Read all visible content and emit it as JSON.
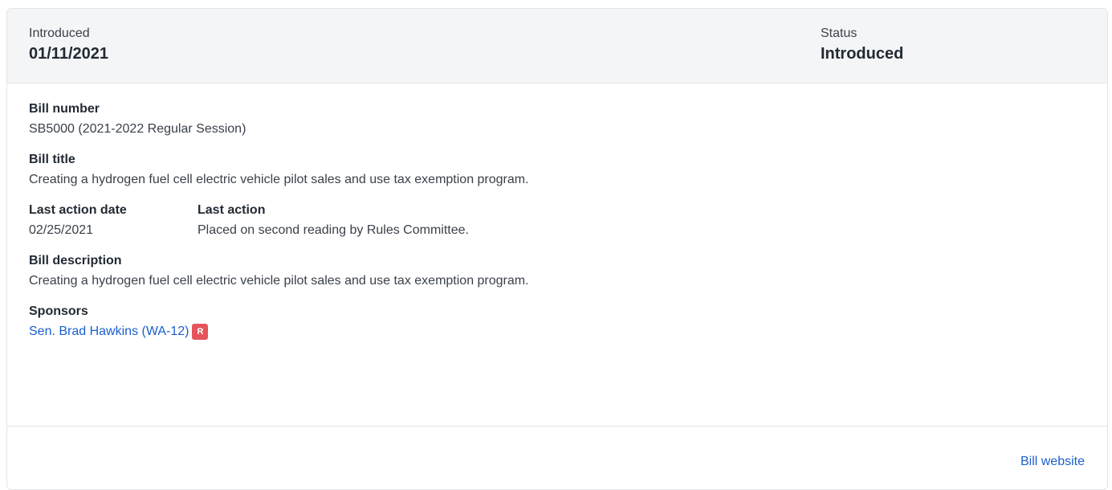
{
  "header": {
    "introduced_label": "Introduced",
    "introduced_value": "01/11/2021",
    "status_label": "Status",
    "status_value": "Introduced"
  },
  "bill": {
    "number_label": "Bill number",
    "number_value": "SB5000 (2021-2022 Regular Session)",
    "title_label": "Bill title",
    "title_value": "Creating a hydrogen fuel cell electric vehicle pilot sales and use tax exemption program.",
    "last_action_date_label": "Last action date",
    "last_action_date_value": "02/25/2021",
    "last_action_label": "Last action",
    "last_action_value": "Placed on second reading by Rules Committee.",
    "description_label": "Bill description",
    "description_value": "Creating a hydrogen fuel cell electric vehicle pilot sales and use tax exemption program."
  },
  "sponsors": {
    "label": "Sponsors",
    "items": [
      {
        "name": "Sen. Brad Hawkins (WA-12)",
        "party": "R",
        "party_color": "#e5545a"
      }
    ]
  },
  "footer": {
    "website_link": "Bill website"
  },
  "colors": {
    "link": "#1a5fd0",
    "header_bg": "#f4f5f7",
    "border": "#e3e5e8"
  }
}
